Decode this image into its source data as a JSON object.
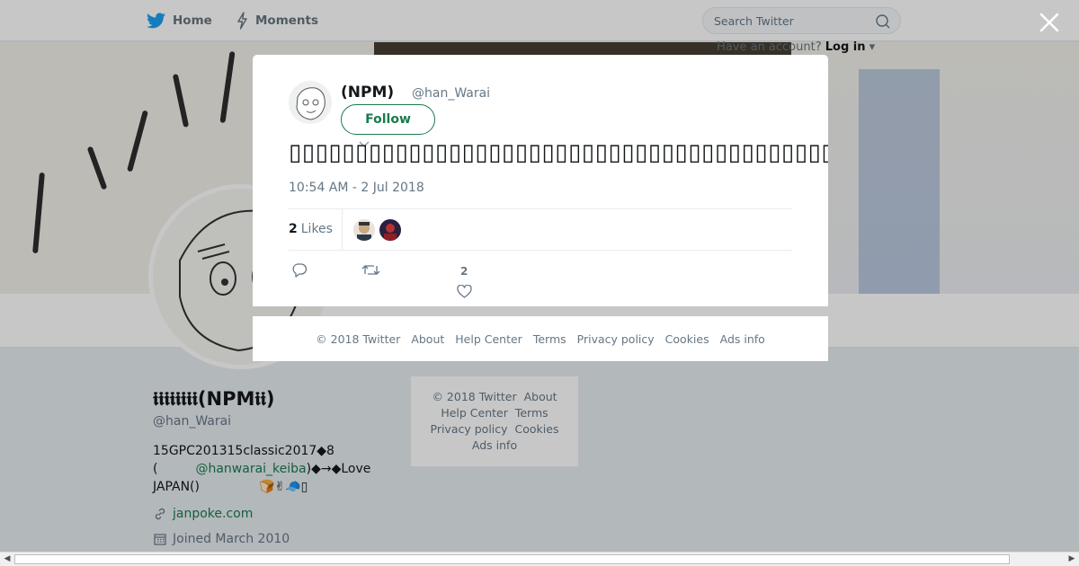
{
  "topbar": {
    "home_label": "Home",
    "moments_label": "Moments",
    "search_placeholder": "Search Twitter",
    "account_prompt": "Have an account?",
    "login_label": "Log in"
  },
  "profile": {
    "name": "𝖎𝖎𝖎𝖎𝖎𝖎𝖎𝖎(NPM𝖎𝖎)",
    "handle": "@han_Warai",
    "bio_line1": "15GPC201315classic2017◆8",
    "bio_line2_prefix": "(",
    "bio_mention": "@hanwarai_keiba",
    "bio_line2_suffix": ")◆→◆Love",
    "bio_line3": "JAPAN()",
    "bio_emoji": "🍞✌🧢▯",
    "website": "janpoke.com",
    "joined": "Joined March 2010"
  },
  "side_footer": {
    "row1": [
      "© 2018 Twitter",
      "About"
    ],
    "row2": [
      "Help Center",
      "Terms"
    ],
    "row3": [
      "Privacy policy",
      "Cookies"
    ],
    "row4": [
      "Ads info"
    ]
  },
  "tweet": {
    "author_name": "(NPM)",
    "author_handle": "@han_Warai",
    "follow_label": "Follow",
    "text": "▯▯▯▯▯▯▯▯▯▯▯▯▯▯▯▯▯▯▯▯▯▯▯▯▯▯▯▯▯▯▯▯▯▯▯▯▯▯▯▯▯▯▯▯▯▯▯▯▯▯▯▯▯▯▯▯▯▯▯▯▯▯▯▯▯▯▯▯\"▯▯▯▯\"▯▯▯▯▯▯▯▯▯▯▯▯▯▯▯▯▯▯",
    "timestamp": "10:54 AM - 2 Jul 2018",
    "likes_count": "2",
    "likes_label": "Likes",
    "like_action_count": "2"
  },
  "dialog_footer": [
    "© 2018 Twitter",
    "About",
    "Help Center",
    "Terms",
    "Privacy policy",
    "Cookies",
    "Ads info"
  ],
  "colors": {
    "accent": "#1b7a4e",
    "twitter_blue": "#1da1f2",
    "muted": "#657786"
  }
}
